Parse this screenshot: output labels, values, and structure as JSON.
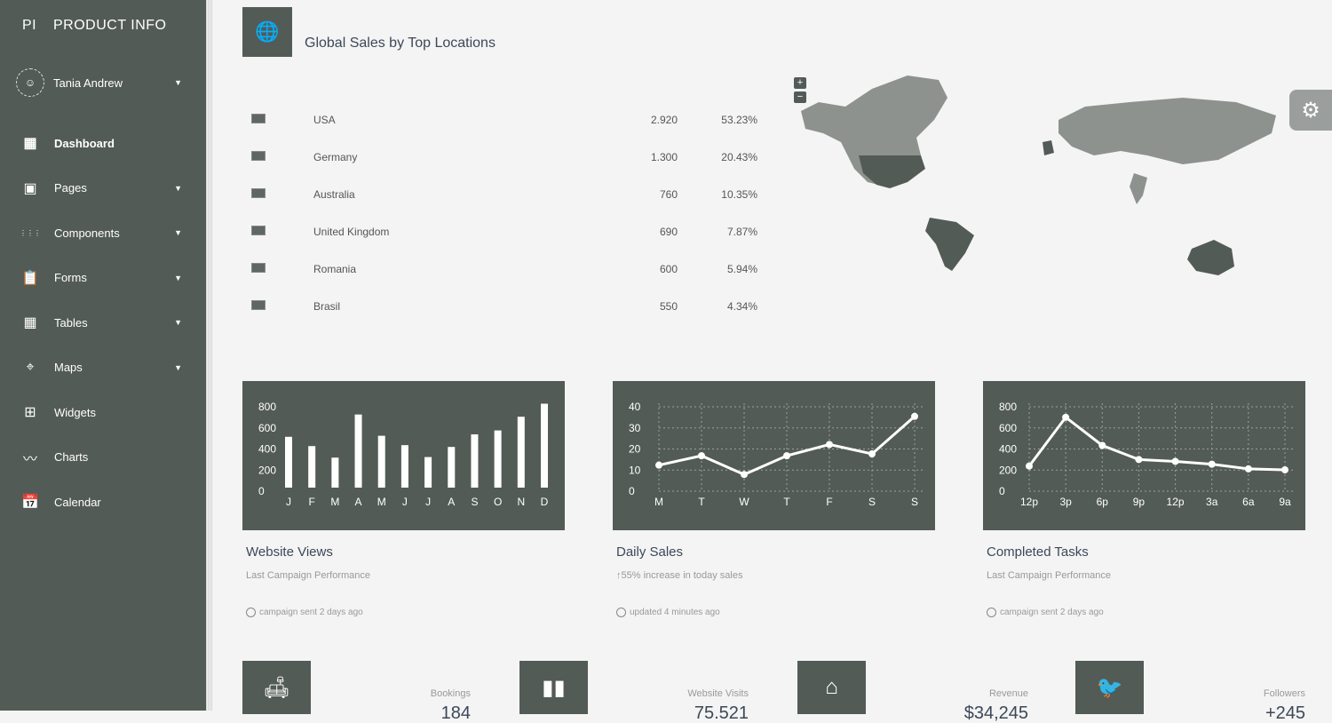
{
  "brand": {
    "mini": "PI",
    "name": "PRODUCT INFO"
  },
  "user": {
    "name": "Tania Andrew"
  },
  "nav": [
    {
      "label": "Dashboard",
      "icon": "dashboard-icon",
      "caret": false,
      "active": true
    },
    {
      "label": "Pages",
      "icon": "image-icon",
      "caret": true
    },
    {
      "label": "Components",
      "icon": "apps-grid-icon",
      "caret": true
    },
    {
      "label": "Forms",
      "icon": "clipboard-icon",
      "caret": true
    },
    {
      "label": "Tables",
      "icon": "grid-table-icon",
      "caret": true
    },
    {
      "label": "Maps",
      "icon": "map-pin-icon",
      "caret": true
    },
    {
      "label": "Widgets",
      "icon": "widgets-icon",
      "caret": false
    },
    {
      "label": "Charts",
      "icon": "timeline-icon",
      "caret": false
    },
    {
      "label": "Calendar",
      "icon": "calendar-icon",
      "caret": false
    }
  ],
  "sales": {
    "title": "Global Sales by Top Locations",
    "rows": [
      {
        "country": "USA",
        "value": "2.920",
        "percent": "53.23%"
      },
      {
        "country": "Germany",
        "value": "1.300",
        "percent": "20.43%"
      },
      {
        "country": "Australia",
        "value": "760",
        "percent": "10.35%"
      },
      {
        "country": "United Kingdom",
        "value": "690",
        "percent": "7.87%"
      },
      {
        "country": "Romania",
        "value": "600",
        "percent": "5.94%"
      },
      {
        "country": "Brasil",
        "value": "550",
        "percent": "4.34%"
      }
    ]
  },
  "map": {
    "zoom_in": "+",
    "zoom_out": "−"
  },
  "cards": [
    {
      "title": "Website Views",
      "subtitle": "Last Campaign Performance",
      "footer": "campaign sent 2 days ago"
    },
    {
      "title": "Daily Sales",
      "subtitle": "55% increase in today sales",
      "subtitle_prefix": "↑",
      "footer": "updated 4 minutes ago"
    },
    {
      "title": "Completed Tasks",
      "subtitle": "Last Campaign Performance",
      "footer": "campaign sent 2 days ago"
    }
  ],
  "stats": [
    {
      "label": "Bookings",
      "value": "184",
      "icon": "sofa-icon"
    },
    {
      "label": "Website Visits",
      "value": "75.521",
      "icon": "bar-chart-icon"
    },
    {
      "label": "Revenue",
      "value": "$34,245",
      "icon": "store-icon"
    },
    {
      "label": "Followers",
      "value": "+245",
      "icon": "twitter-icon"
    }
  ],
  "chart_data": [
    {
      "type": "bar",
      "categories": [
        "J",
        "F",
        "M",
        "A",
        "M",
        "J",
        "J",
        "A",
        "S",
        "O",
        "N",
        "D"
      ],
      "values": [
        542,
        443,
        320,
        780,
        553,
        453,
        326,
        434,
        568,
        610,
        756,
        895
      ],
      "yticks": [
        "800",
        "600",
        "400",
        "200",
        "0"
      ],
      "ylim": [
        0,
        900
      ]
    },
    {
      "type": "line",
      "categories": [
        "M",
        "T",
        "W",
        "T",
        "F",
        "S",
        "S"
      ],
      "values": [
        12,
        17,
        7,
        17,
        23,
        18,
        38
      ],
      "yticks": [
        "40",
        "30",
        "20",
        "10",
        "0"
      ],
      "ylim": [
        0,
        45
      ]
    },
    {
      "type": "line",
      "categories": [
        "12p",
        "3p",
        "6p",
        "9p",
        "12p",
        "3a",
        "6a",
        "9a"
      ],
      "values": [
        230,
        750,
        450,
        300,
        280,
        250,
        200,
        190
      ],
      "yticks": [
        "800",
        "600",
        "400",
        "200",
        "0"
      ],
      "ylim": [
        0,
        900
      ]
    }
  ]
}
